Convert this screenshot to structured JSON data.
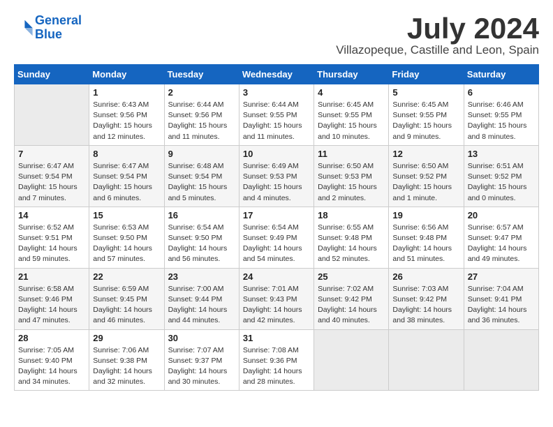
{
  "logo": {
    "line1": "General",
    "line2": "Blue"
  },
  "title": "July 2024",
  "location": "Villazopeque, Castille and Leon, Spain",
  "weekdays": [
    "Sunday",
    "Monday",
    "Tuesday",
    "Wednesday",
    "Thursday",
    "Friday",
    "Saturday"
  ],
  "weeks": [
    [
      {
        "day": "",
        "empty": true
      },
      {
        "day": "1",
        "sunrise": "Sunrise: 6:43 AM",
        "sunset": "Sunset: 9:56 PM",
        "daylight": "Daylight: 15 hours and 12 minutes."
      },
      {
        "day": "2",
        "sunrise": "Sunrise: 6:44 AM",
        "sunset": "Sunset: 9:56 PM",
        "daylight": "Daylight: 15 hours and 11 minutes."
      },
      {
        "day": "3",
        "sunrise": "Sunrise: 6:44 AM",
        "sunset": "Sunset: 9:55 PM",
        "daylight": "Daylight: 15 hours and 11 minutes."
      },
      {
        "day": "4",
        "sunrise": "Sunrise: 6:45 AM",
        "sunset": "Sunset: 9:55 PM",
        "daylight": "Daylight: 15 hours and 10 minutes."
      },
      {
        "day": "5",
        "sunrise": "Sunrise: 6:45 AM",
        "sunset": "Sunset: 9:55 PM",
        "daylight": "Daylight: 15 hours and 9 minutes."
      },
      {
        "day": "6",
        "sunrise": "Sunrise: 6:46 AM",
        "sunset": "Sunset: 9:55 PM",
        "daylight": "Daylight: 15 hours and 8 minutes."
      }
    ],
    [
      {
        "day": "7",
        "sunrise": "Sunrise: 6:47 AM",
        "sunset": "Sunset: 9:54 PM",
        "daylight": "Daylight: 15 hours and 7 minutes."
      },
      {
        "day": "8",
        "sunrise": "Sunrise: 6:47 AM",
        "sunset": "Sunset: 9:54 PM",
        "daylight": "Daylight: 15 hours and 6 minutes."
      },
      {
        "day": "9",
        "sunrise": "Sunrise: 6:48 AM",
        "sunset": "Sunset: 9:54 PM",
        "daylight": "Daylight: 15 hours and 5 minutes."
      },
      {
        "day": "10",
        "sunrise": "Sunrise: 6:49 AM",
        "sunset": "Sunset: 9:53 PM",
        "daylight": "Daylight: 15 hours and 4 minutes."
      },
      {
        "day": "11",
        "sunrise": "Sunrise: 6:50 AM",
        "sunset": "Sunset: 9:53 PM",
        "daylight": "Daylight: 15 hours and 2 minutes."
      },
      {
        "day": "12",
        "sunrise": "Sunrise: 6:50 AM",
        "sunset": "Sunset: 9:52 PM",
        "daylight": "Daylight: 15 hours and 1 minute."
      },
      {
        "day": "13",
        "sunrise": "Sunrise: 6:51 AM",
        "sunset": "Sunset: 9:52 PM",
        "daylight": "Daylight: 15 hours and 0 minutes."
      }
    ],
    [
      {
        "day": "14",
        "sunrise": "Sunrise: 6:52 AM",
        "sunset": "Sunset: 9:51 PM",
        "daylight": "Daylight: 14 hours and 59 minutes."
      },
      {
        "day": "15",
        "sunrise": "Sunrise: 6:53 AM",
        "sunset": "Sunset: 9:50 PM",
        "daylight": "Daylight: 14 hours and 57 minutes."
      },
      {
        "day": "16",
        "sunrise": "Sunrise: 6:54 AM",
        "sunset": "Sunset: 9:50 PM",
        "daylight": "Daylight: 14 hours and 56 minutes."
      },
      {
        "day": "17",
        "sunrise": "Sunrise: 6:54 AM",
        "sunset": "Sunset: 9:49 PM",
        "daylight": "Daylight: 14 hours and 54 minutes."
      },
      {
        "day": "18",
        "sunrise": "Sunrise: 6:55 AM",
        "sunset": "Sunset: 9:48 PM",
        "daylight": "Daylight: 14 hours and 52 minutes."
      },
      {
        "day": "19",
        "sunrise": "Sunrise: 6:56 AM",
        "sunset": "Sunset: 9:48 PM",
        "daylight": "Daylight: 14 hours and 51 minutes."
      },
      {
        "day": "20",
        "sunrise": "Sunrise: 6:57 AM",
        "sunset": "Sunset: 9:47 PM",
        "daylight": "Daylight: 14 hours and 49 minutes."
      }
    ],
    [
      {
        "day": "21",
        "sunrise": "Sunrise: 6:58 AM",
        "sunset": "Sunset: 9:46 PM",
        "daylight": "Daylight: 14 hours and 47 minutes."
      },
      {
        "day": "22",
        "sunrise": "Sunrise: 6:59 AM",
        "sunset": "Sunset: 9:45 PM",
        "daylight": "Daylight: 14 hours and 46 minutes."
      },
      {
        "day": "23",
        "sunrise": "Sunrise: 7:00 AM",
        "sunset": "Sunset: 9:44 PM",
        "daylight": "Daylight: 14 hours and 44 minutes."
      },
      {
        "day": "24",
        "sunrise": "Sunrise: 7:01 AM",
        "sunset": "Sunset: 9:43 PM",
        "daylight": "Daylight: 14 hours and 42 minutes."
      },
      {
        "day": "25",
        "sunrise": "Sunrise: 7:02 AM",
        "sunset": "Sunset: 9:42 PM",
        "daylight": "Daylight: 14 hours and 40 minutes."
      },
      {
        "day": "26",
        "sunrise": "Sunrise: 7:03 AM",
        "sunset": "Sunset: 9:42 PM",
        "daylight": "Daylight: 14 hours and 38 minutes."
      },
      {
        "day": "27",
        "sunrise": "Sunrise: 7:04 AM",
        "sunset": "Sunset: 9:41 PM",
        "daylight": "Daylight: 14 hours and 36 minutes."
      }
    ],
    [
      {
        "day": "28",
        "sunrise": "Sunrise: 7:05 AM",
        "sunset": "Sunset: 9:40 PM",
        "daylight": "Daylight: 14 hours and 34 minutes."
      },
      {
        "day": "29",
        "sunrise": "Sunrise: 7:06 AM",
        "sunset": "Sunset: 9:38 PM",
        "daylight": "Daylight: 14 hours and 32 minutes."
      },
      {
        "day": "30",
        "sunrise": "Sunrise: 7:07 AM",
        "sunset": "Sunset: 9:37 PM",
        "daylight": "Daylight: 14 hours and 30 minutes."
      },
      {
        "day": "31",
        "sunrise": "Sunrise: 7:08 AM",
        "sunset": "Sunset: 9:36 PM",
        "daylight": "Daylight: 14 hours and 28 minutes."
      },
      {
        "day": "",
        "empty": true
      },
      {
        "day": "",
        "empty": true
      },
      {
        "day": "",
        "empty": true
      }
    ]
  ]
}
